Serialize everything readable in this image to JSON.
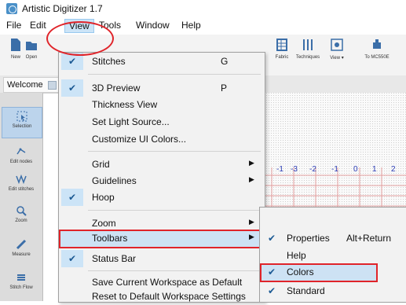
{
  "app": {
    "title": "Artistic Digitizer 1.7"
  },
  "menubar": [
    "File",
    "Edit",
    "View",
    "Tools",
    "Window",
    "Help"
  ],
  "toolbar": {
    "left": [
      "New",
      "Open"
    ],
    "right": [
      "Fabric",
      "Techniques",
      "View",
      "To MC550E"
    ]
  },
  "tab": {
    "label": "Welcome"
  },
  "leftpanel": [
    "Selection",
    "Edit nodes",
    "Edit stitches",
    "Zoom",
    "Measure",
    "Stitch Flow"
  ],
  "view_menu": [
    {
      "label": "Stitches",
      "shortcut": "G",
      "checked": true
    },
    {
      "label": "3D Preview",
      "shortcut": "P",
      "checked": true
    },
    {
      "label": "Thickness View",
      "checked": false
    },
    {
      "label": "Set Light Source...",
      "checked": false
    },
    {
      "label": "Customize UI Colors...",
      "checked": false
    },
    {
      "label": "Grid",
      "submenu": true
    },
    {
      "label": "Guidelines",
      "submenu": true
    },
    {
      "label": "Hoop",
      "checked": true
    },
    {
      "label": "Zoom",
      "submenu": true
    },
    {
      "label": "Toolbars",
      "submenu": true,
      "highlighted": true
    },
    {
      "label": "Status Bar",
      "checked": true
    },
    {
      "label": "Save Current Workspace as Default"
    },
    {
      "label": "Reset to Default Workspace Settings"
    }
  ],
  "toolbars_submenu": [
    {
      "label": "Properties",
      "shortcut": "Alt+Return",
      "checked": true
    },
    {
      "label": "Help",
      "checked": false
    },
    {
      "label": "Colors",
      "checked": true,
      "highlighted": true
    },
    {
      "label": "Standard",
      "checked": true
    }
  ],
  "canvas": {
    "ruler_labels": [
      "-1",
      "-3",
      "-2",
      "-1",
      "0",
      "1",
      "2"
    ]
  },
  "colors": {
    "highlight": "#cde2f4",
    "annotation": "#e0242a",
    "check": "#1c5a94"
  }
}
